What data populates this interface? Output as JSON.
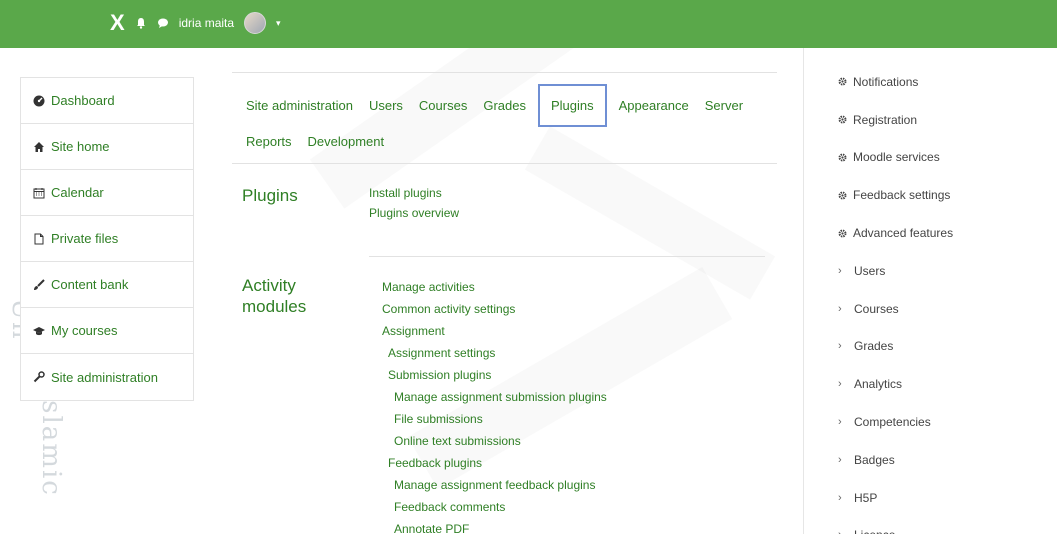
{
  "topbar": {
    "close_glyph": "X",
    "username": "idria maita",
    "caret": "▾"
  },
  "watermark_text": "State Islamic Un",
  "left_nav": [
    {
      "label": "Dashboard",
      "icon": "dashboard-icon"
    },
    {
      "label": "Site home",
      "icon": "home-icon"
    },
    {
      "label": "Calendar",
      "icon": "calendar-icon"
    },
    {
      "label": "Private files",
      "icon": "file-icon"
    },
    {
      "label": "Content bank",
      "icon": "brush-icon"
    },
    {
      "label": "My courses",
      "icon": "graduation-cap-icon"
    },
    {
      "label": "Site administration",
      "icon": "wrench-icon"
    }
  ],
  "tabs_row1": [
    "Site administration",
    "Users",
    "Courses",
    "Grades",
    "Plugins",
    "Appearance",
    "Server"
  ],
  "tabs_row2": [
    "Reports",
    "Development"
  ],
  "active_tab": "Plugins",
  "plugins_section": {
    "title": "Plugins",
    "links": [
      "Install plugins",
      "Plugins overview"
    ]
  },
  "activity_section": {
    "title_line1": "Activity",
    "title_line2": "modules",
    "links": [
      {
        "text": "Manage activities",
        "level": 1
      },
      {
        "text": "Common activity settings",
        "level": 1
      },
      {
        "text": "Assignment",
        "level": 1
      },
      {
        "text": "Assignment settings",
        "level": 2
      },
      {
        "text": "Submission plugins",
        "level": 2
      },
      {
        "text": "Manage assignment submission plugins",
        "level": 3
      },
      {
        "text": "File submissions",
        "level": 3
      },
      {
        "text": "Online text submissions",
        "level": 3
      },
      {
        "text": "Feedback plugins",
        "level": 2
      },
      {
        "text": "Manage assignment feedback plugins",
        "level": 3
      },
      {
        "text": "Feedback comments",
        "level": 3
      },
      {
        "text": "Annotate PDF",
        "level": 3
      }
    ]
  },
  "right_panel": [
    {
      "label": "Notifications",
      "kind": "gear"
    },
    {
      "label": "Registration",
      "kind": "gear"
    },
    {
      "label": "Moodle services",
      "kind": "gear"
    },
    {
      "label": "Feedback settings",
      "kind": "gear"
    },
    {
      "label": "Advanced features",
      "kind": "gear"
    },
    {
      "label": "Users",
      "kind": "chevron"
    },
    {
      "label": "Courses",
      "kind": "chevron"
    },
    {
      "label": "Grades",
      "kind": "chevron"
    },
    {
      "label": "Analytics",
      "kind": "chevron"
    },
    {
      "label": "Competencies",
      "kind": "chevron"
    },
    {
      "label": "Badges",
      "kind": "chevron"
    },
    {
      "label": "H5P",
      "kind": "chevron"
    },
    {
      "label": "Licence",
      "kind": "chevron"
    }
  ],
  "colors": {
    "topbar": "#5aa84a",
    "link": "#2f7f25",
    "active_tab_border": "#6f8fd4"
  }
}
